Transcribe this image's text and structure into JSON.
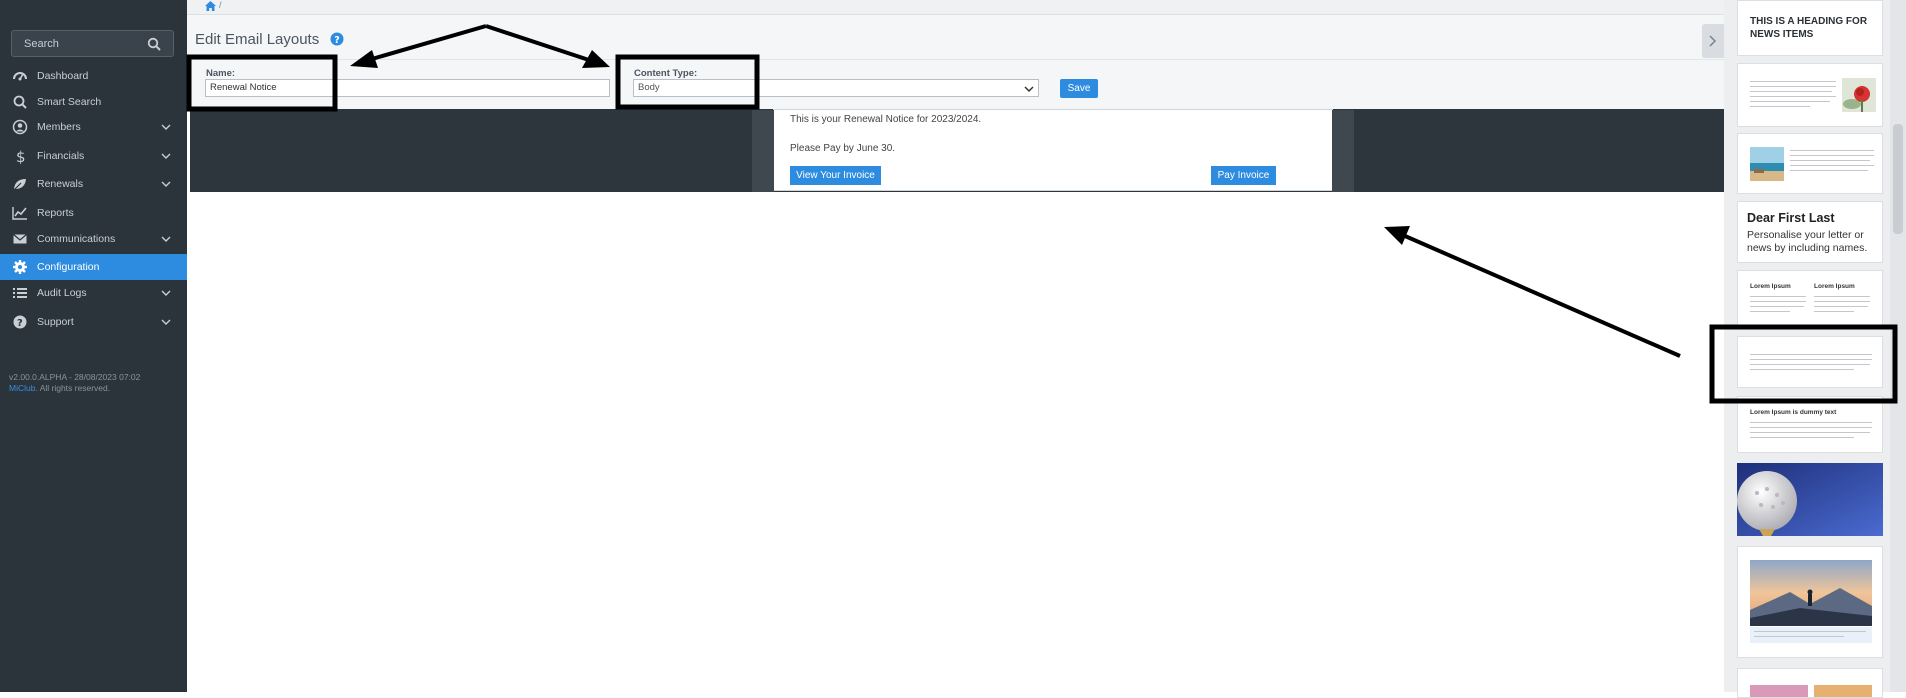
{
  "sidebar": {
    "search_placeholder": "Search",
    "items": [
      {
        "label": "Dashboard",
        "icon": "dashboard-icon"
      },
      {
        "label": "Smart Search",
        "icon": "search-icon"
      },
      {
        "label": "Members",
        "icon": "user-circle-icon"
      },
      {
        "label": "Financials",
        "icon": "dollar-icon"
      },
      {
        "label": "Renewals",
        "icon": "leaf-icon"
      },
      {
        "label": "Reports",
        "icon": "line-chart-icon"
      },
      {
        "label": "Communications",
        "icon": "envelope-icon"
      },
      {
        "label": "Configuration",
        "icon": "gear-icon"
      },
      {
        "label": "Audit Logs",
        "icon": "list-icon"
      },
      {
        "label": "Support",
        "icon": "question-circle-icon"
      }
    ],
    "version": "v2.00.0.ALPHA - 28/08/2023 07:02",
    "brand": "MiClub.",
    "rights": " All rights reserved."
  },
  "breadcrumb": {
    "separator": "/"
  },
  "page": {
    "title": "Edit Email Layouts",
    "name_label": "Name:",
    "name_value": "Renewal Notice",
    "content_type_label": "Content Type:",
    "content_type_value": "Body",
    "save_label": "Save"
  },
  "preview": {
    "line1": "This is your Renewal Notice for 2023/2024.",
    "line2": "Please Pay by June 30.",
    "view_invoice": "View Your Invoice",
    "pay_invoice": "Pay Invoice"
  },
  "templates": {
    "heading": "THIS IS A HEADING FOR NEWS ITEMS",
    "dear_title": "Dear First Last",
    "dear_sub": "Personalise your letter or news by including names.",
    "col1_head": "Lorem Ipsum",
    "col2_head": "Lorem Ipsum",
    "dummy_head": "Lorem Ipsum is dummy text"
  },
  "colors": {
    "sidebar_bg": "#2b333b",
    "accent": "#2e8ce0",
    "preview_band": "#2d353d"
  }
}
